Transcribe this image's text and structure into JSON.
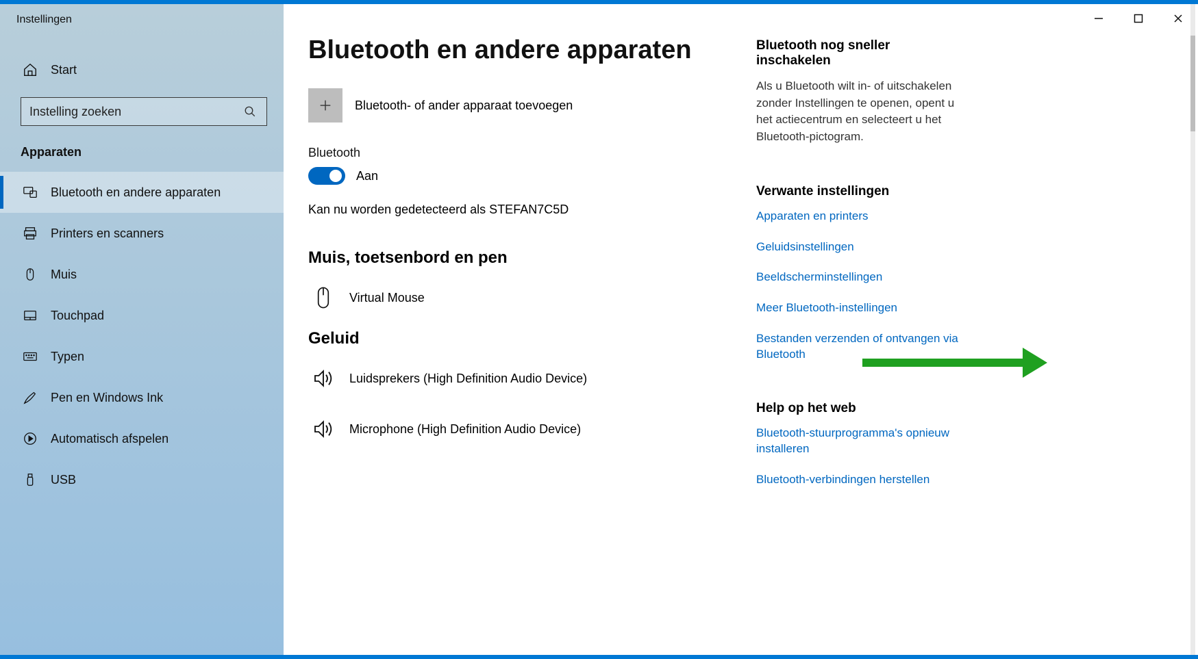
{
  "window": {
    "title": "Instellingen"
  },
  "sidebar": {
    "home_label": "Start",
    "search_placeholder": "Instelling zoeken",
    "category_label": "Apparaten",
    "items": [
      {
        "label": "Bluetooth en andere apparaten",
        "active": true
      },
      {
        "label": "Printers en scanners",
        "active": false
      },
      {
        "label": "Muis",
        "active": false
      },
      {
        "label": "Touchpad",
        "active": false
      },
      {
        "label": "Typen",
        "active": false
      },
      {
        "label": "Pen en Windows Ink",
        "active": false
      },
      {
        "label": "Automatisch afspelen",
        "active": false
      },
      {
        "label": "USB",
        "active": false
      }
    ]
  },
  "main": {
    "title": "Bluetooth en andere apparaten",
    "add_device_label": "Bluetooth- of ander apparaat toevoegen",
    "bluetooth_label": "Bluetooth",
    "toggle_state": "Aan",
    "status_text": "Kan nu worden gedetecteerd als STEFAN7C5D",
    "sections": {
      "mouse_heading": "Muis, toetsenbord en pen",
      "mouse_device": "Virtual Mouse",
      "audio_heading": "Geluid",
      "audio_speakers": "Luidsprekers (High Definition Audio Device)",
      "audio_mic": "Microphone (High Definition Audio Device)"
    }
  },
  "aside": {
    "quick_heading": "Bluetooth nog sneller inschakelen",
    "quick_body": "Als u Bluetooth wilt in- of uitschakelen zonder Instellingen te openen, opent u het actiecentrum en selecteert u het Bluetooth-pictogram.",
    "related_heading": "Verwante instellingen",
    "related_links": [
      "Apparaten en printers",
      "Geluidsinstellingen",
      "Beeldscherminstellingen",
      "Meer Bluetooth-instellingen",
      "Bestanden verzenden of ontvangen via Bluetooth"
    ],
    "help_heading": "Help op het web",
    "help_links": [
      "Bluetooth-stuurprogramma's opnieuw installeren",
      "Bluetooth-verbindingen herstellen"
    ]
  }
}
